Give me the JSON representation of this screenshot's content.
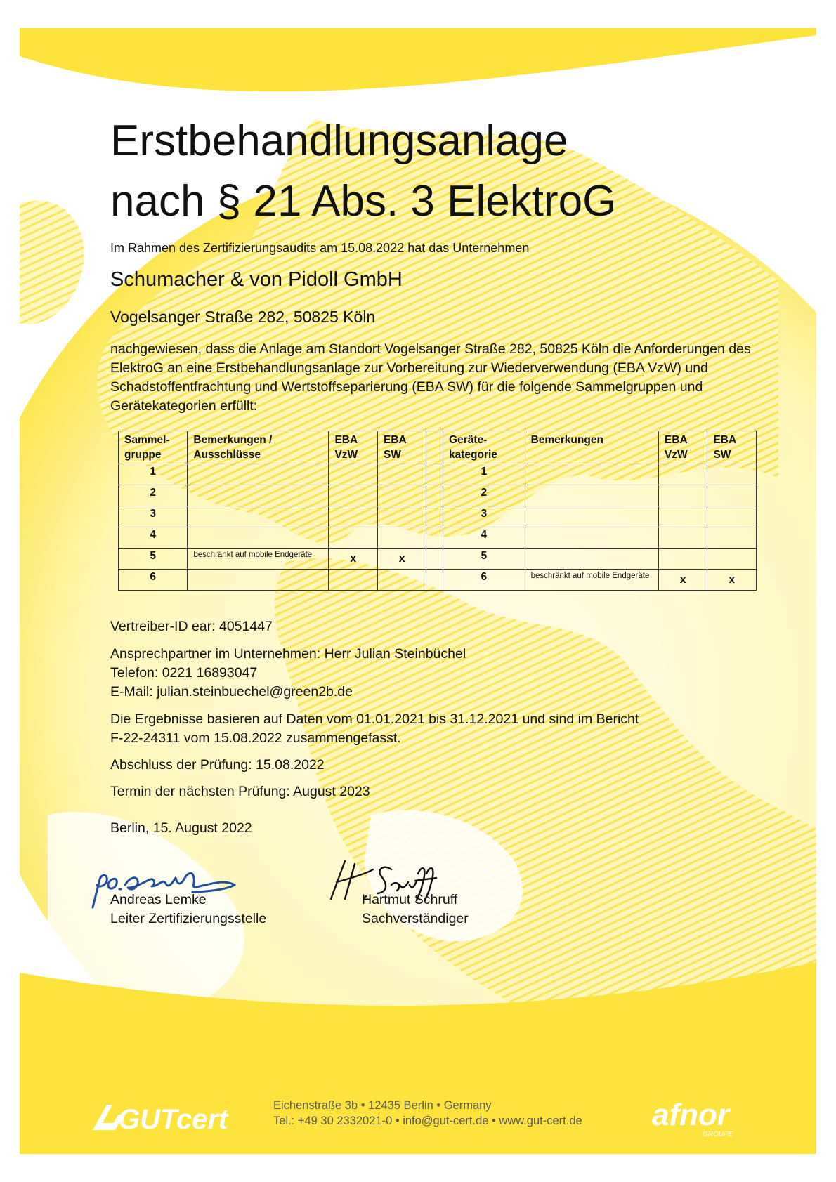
{
  "title_line1": "Erstbehandlungsanlage",
  "title_line2": "nach § 21 Abs. 3 ElektroG",
  "intro": "Im Rahmen des Zertifizierungsaudits am 15.08.2022 hat das Unternehmen",
  "company": "Schumacher & von Pidoll GmbH",
  "address": "Vogelsanger Straße 282, 50825 Köln",
  "paragraph": "nachgewiesen, dass die Anlage am Standort Vogelsanger Straße 282, 50825 Köln die Anforderungen des ElektroG an eine Erstbehandlungsanlage zur Vorbereitung zur Wiederverwendung (EBA VzW) und Schadstoffentfrachtung und Wertstoffseparierung (EBA SW) für die folgende Sammelgruppen und Gerätekategorien erfüllt:",
  "table": {
    "headers": {
      "sammelgruppe": "Sammel-gruppe",
      "bemerkungen_ausschluesse": "Bemerkungen / Ausschlüsse",
      "eba_vzw": "EBA VzW",
      "eba_sw": "EBA SW",
      "geraetekategorie": "Geräte-kategorie",
      "bemerkungen": "Bemerkungen",
      "eba_vzw2": "EBA VzW",
      "eba_sw2": "EBA SW"
    },
    "rows": [
      {
        "group": "1",
        "note": "",
        "vzw": "",
        "sw": "",
        "cat": "1",
        "note2": "",
        "vzw2": "",
        "sw2": ""
      },
      {
        "group": "2",
        "note": "",
        "vzw": "",
        "sw": "",
        "cat": "2",
        "note2": "",
        "vzw2": "",
        "sw2": ""
      },
      {
        "group": "3",
        "note": "",
        "vzw": "",
        "sw": "",
        "cat": "3",
        "note2": "",
        "vzw2": "",
        "sw2": ""
      },
      {
        "group": "4",
        "note": "",
        "vzw": "",
        "sw": "",
        "cat": "4",
        "note2": "",
        "vzw2": "",
        "sw2": ""
      },
      {
        "group": "5",
        "note": "beschränkt auf mobile Endgeräte",
        "vzw": "x",
        "sw": "x",
        "cat": "5",
        "note2": "",
        "vzw2": "",
        "sw2": ""
      },
      {
        "group": "6",
        "note": "",
        "vzw": "",
        "sw": "",
        "cat": "6",
        "note2": "beschränkt auf mobile Endgeräte",
        "vzw2": "x",
        "sw2": "x"
      }
    ]
  },
  "vertreiber": "Vertreiber-ID ear: 4051447",
  "contact": {
    "person": "Ansprechpartner im Unternehmen: Herr Julian Steinbüchel",
    "phone": "Telefon: 0221 16893047",
    "email": "E-Mail: julian.steinbuechel@green2b.de"
  },
  "results_line1": "Die Ergebnisse basieren auf Daten vom 01.01.2021 bis 31.12.2021 und sind im Bericht",
  "results_line2": "F-22-24311 vom 15.08.2022 zusammengefasst.",
  "abschluss": "Abschluss der Prüfung: 15.08.2022",
  "termin": "Termin der nächsten Prüfung: August 2023",
  "place_date": "Berlin, 15. August 2022",
  "signatories": [
    {
      "name": "Andreas Lemke",
      "role": "Leiter Zertifizierungsstelle",
      "signature": "ppa. Lemke"
    },
    {
      "name": "Hartmut Schruff",
      "role": "Sachverständiger",
      "signature": "H. Schruff"
    }
  ],
  "footer": {
    "logo": "GUTcert",
    "address_line1": "Eichenstraße 3b • 12435 Berlin • Germany",
    "address_line2": "Tel.: +49 30 2332021-0 • info@gut-cert.de • www.gut-cert.de",
    "partner_logo": "afnor",
    "partner_sub": "GROUPE"
  },
  "colors": {
    "accent": "#fde33b",
    "light": "#fff7b8",
    "text": "#111111",
    "signature_blue": "#1f4e9c"
  }
}
